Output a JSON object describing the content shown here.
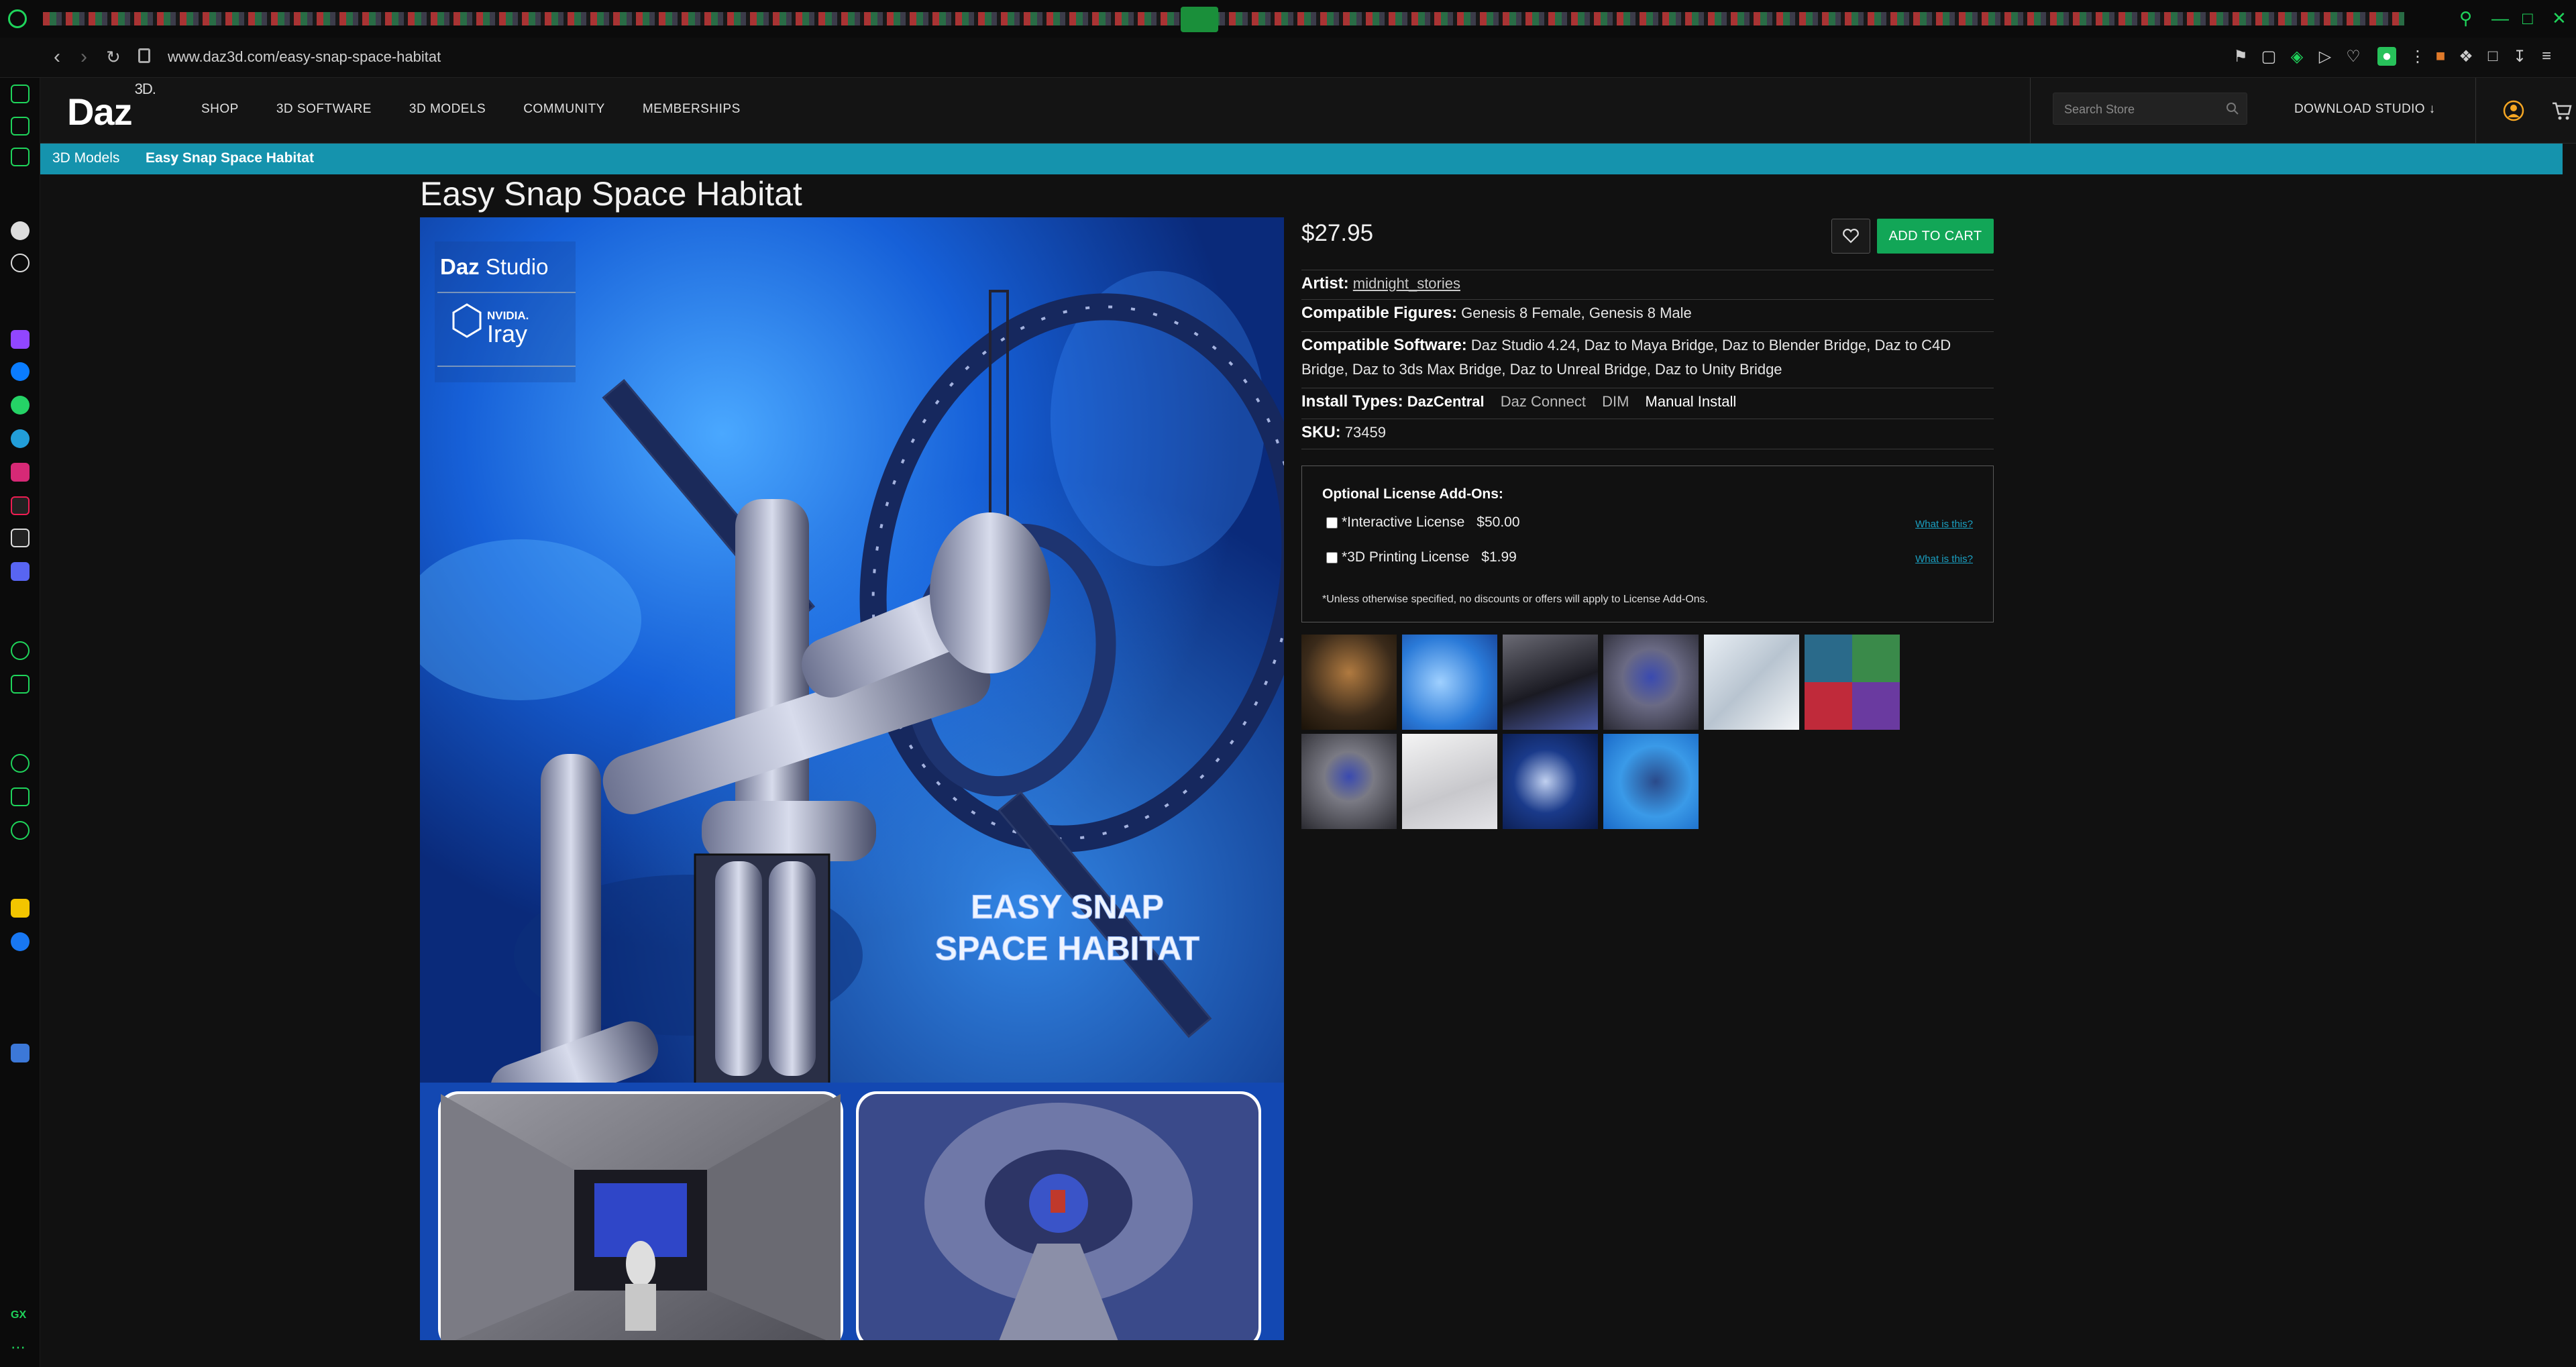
{
  "browser": {
    "url": "www.daz3d.com/easy-snap-space-habitat",
    "icons": [
      "back-icon",
      "forward-icon",
      "reload-icon",
      "lock-icon"
    ]
  },
  "header": {
    "logo_text": "Daz",
    "logo_sup": "3D.",
    "nav": [
      "SHOP",
      "3D SOFTWARE",
      "3D MODELS",
      "COMMUNITY",
      "MEMBERSHIPS"
    ],
    "search_placeholder": "Search Store",
    "download_label": "DOWNLOAD STUDIO ↓"
  },
  "breadcrumb": {
    "parent": "3D Models",
    "separator": "›",
    "current": "Easy Snap Space Habitat"
  },
  "product": {
    "title": "Easy Snap Space Habitat",
    "price": "$27.95",
    "add_to_cart": "ADD TO CART",
    "artist_label": "Artist:",
    "artist": "midnight_stories",
    "figures_label": "Compatible Figures:",
    "figures": "Genesis 8 Female, Genesis 8 Male",
    "software_label": "Compatible Software:",
    "software": "Daz Studio 4.24, Daz to Maya Bridge, Daz to Blender Bridge, Daz to C4D Bridge, Daz to 3ds Max Bridge, Daz to Unreal Bridge, Daz to Unity Bridge",
    "install_label": "Install Types:",
    "install_types": [
      "DazCentral",
      "Daz Connect",
      "DIM",
      "Manual Install"
    ],
    "sku_label": "SKU:",
    "sku": "73459"
  },
  "hero": {
    "badge_studio": "Daz Studio",
    "badge_nvidia": "NVIDIA.",
    "badge_iray": "Iray",
    "overlay_line1": "EASY SNAP",
    "overlay_line2": "SPACE HABITAT"
  },
  "license": {
    "title": "Optional License Add-Ons:",
    "items": [
      {
        "name": "*Interactive License",
        "price": "$50.00",
        "help": "What is this?"
      },
      {
        "name": "*3D Printing License",
        "price": "$1.99",
        "help": "What is this?"
      }
    ],
    "note": "*Unless otherwise specified, no discounts or offers will apply to License Add-Ons."
  },
  "thumbnails_count": 10
}
